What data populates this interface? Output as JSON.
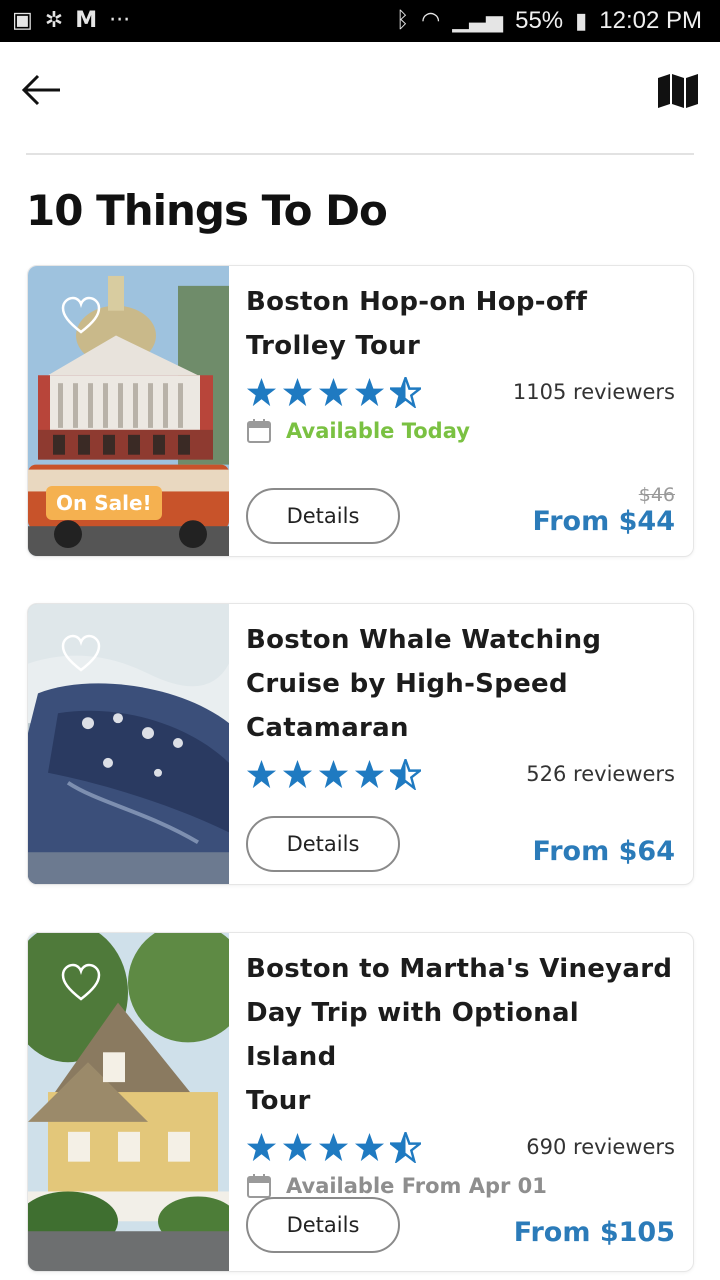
{
  "status_bar": {
    "battery": "55%",
    "time": "12:02 PM"
  },
  "page": {
    "title": "10 Things To Do"
  },
  "colors": {
    "accent": "#2b7bb9",
    "star": "#1f7ac1",
    "available": "#7ac142",
    "sale_badge": "#f5b150"
  },
  "cards": [
    {
      "title_line1": "Boston Hop-on Hop-off",
      "title_line2": "Trolley Tour",
      "rating": 4.5,
      "reviewers": "1105 reviewers",
      "availability": "Available Today",
      "badge": "On Sale!",
      "details_label": "Details",
      "old_price": "$46",
      "price": "From $44"
    },
    {
      "title_line1": "Boston Whale Watching",
      "title_line2": "Cruise by High-Speed",
      "title_line3": "Catamaran",
      "rating": 4.5,
      "reviewers": "526 reviewers",
      "details_label": "Details",
      "price": "From $64"
    },
    {
      "title_line1": "Boston to Martha's Vineyard",
      "title_line2": "Day Trip with Optional Island",
      "title_line3": "Tour",
      "rating": 4.5,
      "reviewers": "690 reviewers",
      "availability": "Available From Apr 01",
      "details_label": "Details",
      "price": "From $105"
    }
  ]
}
